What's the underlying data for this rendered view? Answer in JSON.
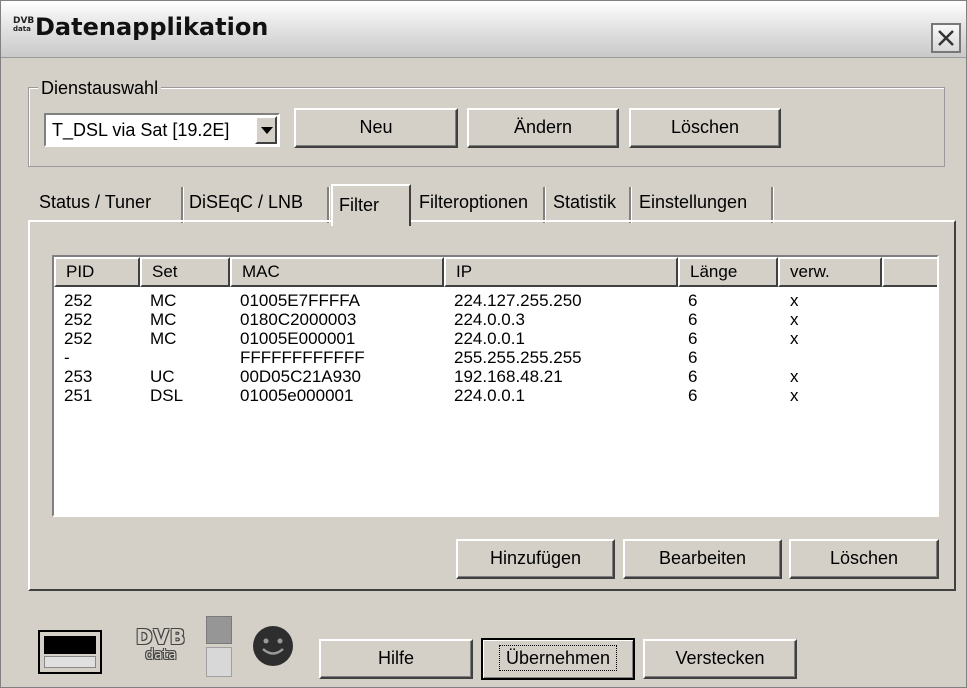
{
  "window": {
    "title": "Datenapplikation",
    "icon_text_top": "DVB",
    "icon_text_bottom": "data",
    "close_glyph": "✕"
  },
  "service_selection": {
    "group_label": "Dienstauswahl",
    "selected_service": "T_DSL via Sat [19.2E]",
    "new_label": "Neu",
    "change_label": "Ändern",
    "delete_label": "Löschen"
  },
  "tabs": [
    {
      "label": "Status / Tuner",
      "active": false
    },
    {
      "label": "DiSEqC / LNB",
      "active": false
    },
    {
      "label": "Filter",
      "active": true
    },
    {
      "label": "Filteroptionen",
      "active": false
    },
    {
      "label": "Statistik",
      "active": false
    },
    {
      "label": "Einstellungen",
      "active": false
    }
  ],
  "filter_table": {
    "columns": [
      "PID",
      "Set",
      "MAC",
      "IP",
      "Länge",
      "verw."
    ],
    "rows": [
      {
        "pid": "252",
        "set": "MC",
        "mac": "01005E7FFFFA",
        "ip": "224.127.255.250",
        "laenge": "6",
        "verw": "x"
      },
      {
        "pid": "252",
        "set": "MC",
        "mac": "0180C2000003",
        "ip": "224.0.0.3",
        "laenge": "6",
        "verw": "x"
      },
      {
        "pid": "252",
        "set": "MC",
        "mac": "01005E000001",
        "ip": "224.0.0.1",
        "laenge": "6",
        "verw": "x"
      },
      {
        "pid": "-",
        "set": "",
        "mac": "FFFFFFFFFFFF",
        "ip": "255.255.255.255",
        "laenge": "6",
        "verw": ""
      },
      {
        "pid": "253",
        "set": "UC",
        "mac": "00D05C21A930",
        "ip": "192.168.48.21",
        "laenge": "6",
        "verw": "x"
      },
      {
        "pid": "251",
        "set": "DSL",
        "mac": "01005e000001",
        "ip": "224.0.0.1",
        "laenge": "6",
        "verw": "x"
      }
    ]
  },
  "filter_actions": {
    "add_label": "Hinzufügen",
    "edit_label": "Bearbeiten",
    "delete_label": "Löschen"
  },
  "footer": {
    "logo_top": "DVB",
    "logo_bottom": "data",
    "help_label": "Hilfe",
    "apply_label": "Übernehmen",
    "hide_label": "Verstecken"
  }
}
